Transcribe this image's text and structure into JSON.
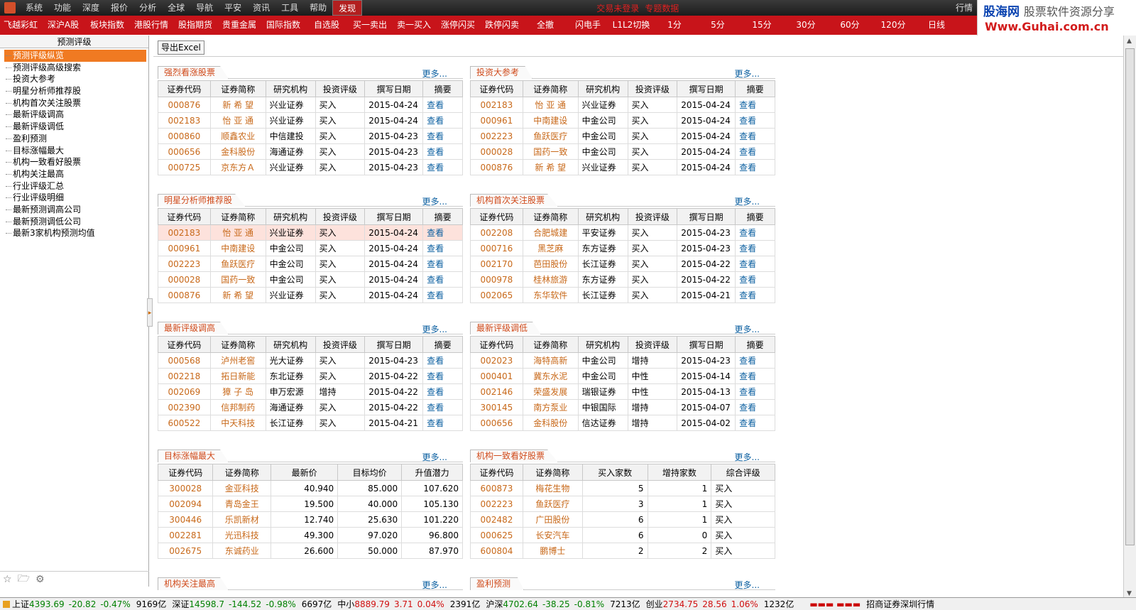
{
  "menubar": {
    "items": [
      "系统",
      "功能",
      "深度",
      "报价",
      "分析",
      "全球",
      "导航",
      "平安",
      "资讯",
      "工具",
      "帮助"
    ],
    "active": "发现",
    "warnings": [
      "交易未登录",
      "专题数据"
    ],
    "right_label": "行情"
  },
  "brand": {
    "cn": "股海网",
    "slogan": "股票软件资源分享",
    "url": "Www.Guhai.com.cn"
  },
  "toolbar": [
    "飞越彩虹",
    "深沪A股",
    "板块指数",
    "港股行情",
    "股指期货",
    "贵重金属",
    "国际指数",
    "自选股",
    "买一卖出",
    "卖一买入",
    "涨停闪买",
    "跌停闪卖",
    "全撤",
    "闪电手",
    "L1L2切换",
    "1分",
    "5分",
    "15分",
    "30分",
    "60分",
    "120分",
    "日线"
  ],
  "left_panel": {
    "title": "预测评级",
    "items": [
      "预测评级纵览",
      "预测评级高级搜索",
      "投资大参考",
      "明星分析师推荐股",
      "机构首次关注股票",
      "最新评级调高",
      "最新评级调低",
      "盈利预测",
      "目标涨幅最大",
      "机构一致看好股票",
      "机构关注最高",
      "行业评级汇总",
      "行业评级明细",
      "最新预测调高公司",
      "最新预测调低公司",
      "最新3家机构预测均值"
    ],
    "bottom_icons": [
      "star-icon",
      "folder-icon",
      "gear-icon"
    ]
  },
  "export_button": "导出Excel",
  "more_label": "更多...",
  "rating_headers": [
    "证券代码",
    "证券简称",
    "研究机构",
    "投资评级",
    "撰写日期",
    "摘要"
  ],
  "view_label": "查看",
  "panels": [
    {
      "title": "强烈看涨股票",
      "rows": [
        [
          "000876",
          "新 希 望",
          "兴业证券",
          "买入",
          "2015-04-24"
        ],
        [
          "002183",
          "怡 亚 通",
          "兴业证券",
          "买入",
          "2015-04-24"
        ],
        [
          "000860",
          "顺鑫农业",
          "中信建投",
          "买入",
          "2015-04-23"
        ],
        [
          "000656",
          "金科股份",
          "海通证券",
          "买入",
          "2015-04-23"
        ],
        [
          "000725",
          "京东方Ａ",
          "兴业证券",
          "买入",
          "2015-04-23"
        ]
      ]
    },
    {
      "title": "投资大参考",
      "rows": [
        [
          "002183",
          "怡 亚 通",
          "兴业证券",
          "买入",
          "2015-04-24"
        ],
        [
          "000961",
          "中南建设",
          "中金公司",
          "买入",
          "2015-04-24"
        ],
        [
          "002223",
          "鱼跃医疗",
          "中金公司",
          "买入",
          "2015-04-24"
        ],
        [
          "000028",
          "国药一致",
          "中金公司",
          "买入",
          "2015-04-24"
        ],
        [
          "000876",
          "新 希 望",
          "兴业证券",
          "买入",
          "2015-04-24"
        ]
      ]
    },
    {
      "title": "明星分析师推荐股",
      "rows": [
        [
          "002183",
          "怡 亚 通",
          "兴业证券",
          "买入",
          "2015-04-24"
        ],
        [
          "000961",
          "中南建设",
          "中金公司",
          "买入",
          "2015-04-24"
        ],
        [
          "002223",
          "鱼跃医疗",
          "中金公司",
          "买入",
          "2015-04-24"
        ],
        [
          "000028",
          "国药一致",
          "中金公司",
          "买入",
          "2015-04-24"
        ],
        [
          "000876",
          "新 希 望",
          "兴业证券",
          "买入",
          "2015-04-24"
        ]
      ]
    },
    {
      "title": "机构首次关注股票",
      "rows": [
        [
          "002208",
          "合肥城建",
          "平安证券",
          "买入",
          "2015-04-23"
        ],
        [
          "000716",
          "黑芝麻",
          "东方证券",
          "买入",
          "2015-04-23"
        ],
        [
          "002170",
          "芭田股份",
          "长江证券",
          "买入",
          "2015-04-22"
        ],
        [
          "000978",
          "桂林旅游",
          "东方证券",
          "买入",
          "2015-04-22"
        ],
        [
          "002065",
          "东华软件",
          "长江证券",
          "买入",
          "2015-04-21"
        ]
      ]
    },
    {
      "title": "最新评级调高",
      "rows": [
        [
          "000568",
          "泸州老窖",
          "光大证券",
          "买入",
          "2015-04-23"
        ],
        [
          "002218",
          "拓日新能",
          "东北证券",
          "买入",
          "2015-04-22"
        ],
        [
          "002069",
          "獐 子 岛",
          "申万宏源",
          "增持",
          "2015-04-22"
        ],
        [
          "002390",
          "信邦制药",
          "海通证券",
          "买入",
          "2015-04-22"
        ],
        [
          "600522",
          "中天科技",
          "长江证券",
          "买入",
          "2015-04-21"
        ]
      ]
    },
    {
      "title": "最新评级调低",
      "rows": [
        [
          "002023",
          "海特高新",
          "中金公司",
          "增持",
          "2015-04-23"
        ],
        [
          "000401",
          "冀东水泥",
          "中金公司",
          "中性",
          "2015-04-14"
        ],
        [
          "002146",
          "荣盛发展",
          "瑞银证券",
          "中性",
          "2015-04-13"
        ],
        [
          "300145",
          "南方泵业",
          "中银国际",
          "增持",
          "2015-04-07"
        ],
        [
          "000656",
          "金科股份",
          "信达证券",
          "增持",
          "2015-04-02"
        ]
      ]
    }
  ],
  "target_panel": {
    "title": "目标涨幅最大",
    "headers": [
      "证券代码",
      "证券简称",
      "最新价",
      "目标均价",
      "升值潜力"
    ],
    "rows": [
      [
        "300028",
        "金亚科技",
        "40.940",
        "85.000",
        "107.620"
      ],
      [
        "002094",
        "青岛金王",
        "19.500",
        "40.000",
        "105.130"
      ],
      [
        "300446",
        "乐凯新材",
        "12.740",
        "25.630",
        "101.220"
      ],
      [
        "002281",
        "光迅科技",
        "49.300",
        "97.020",
        "96.800"
      ],
      [
        "002675",
        "东诚药业",
        "26.600",
        "50.000",
        "87.970"
      ]
    ]
  },
  "consensus_panel": {
    "title": "机构一致看好股票",
    "headers": [
      "证券代码",
      "证券简称",
      "买入家数",
      "增持家数",
      "综合评级"
    ],
    "rows": [
      [
        "600873",
        "梅花生物",
        "5",
        "1",
        "买入"
      ],
      [
        "002223",
        "鱼跃医疗",
        "3",
        "1",
        "买入"
      ],
      [
        "002482",
        "广田股份",
        "6",
        "1",
        "买入"
      ],
      [
        "000625",
        "长安汽车",
        "6",
        "0",
        "买入"
      ],
      [
        "600804",
        "鹏博士",
        "2",
        "2",
        "买入"
      ]
    ]
  },
  "bottom_panels": [
    "机构关注最高",
    "盈利预测"
  ],
  "statusbar": {
    "items": [
      {
        "name": "上证",
        "value": "4393.69",
        "change": "-20.82",
        "pct": "-0.47%",
        "amount": "9169亿",
        "dir": "dn"
      },
      {
        "name": "深证",
        "value": "14598.7",
        "change": "-144.52",
        "pct": "-0.98%",
        "amount": "6697亿",
        "dir": "dn"
      },
      {
        "name": "中小",
        "value": "8889.79",
        "change": "3.71",
        "pct": "0.04%",
        "amount": "2391亿",
        "dir": "up"
      },
      {
        "name": "沪深",
        "value": "4702.64",
        "change": "-38.25",
        "pct": "-0.81%",
        "amount": "7213亿",
        "dir": "dn"
      },
      {
        "name": "创业",
        "value": "2734.75",
        "change": "28.56",
        "pct": "1.06%",
        "amount": "1232亿",
        "dir": "up"
      }
    ],
    "broker": "招商证券深圳行情"
  }
}
